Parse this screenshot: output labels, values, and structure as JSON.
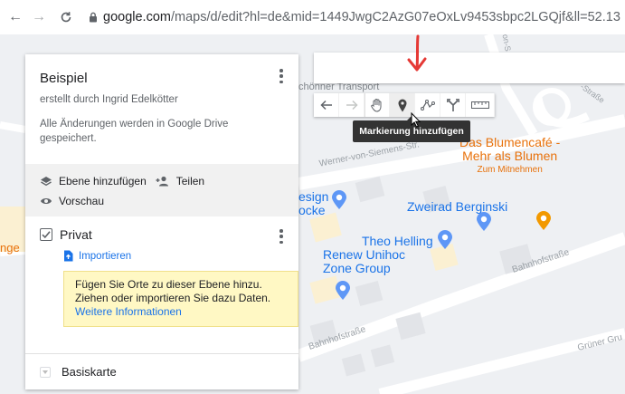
{
  "browser": {
    "url_host": "google.com",
    "url_rest": "/maps/d/edit?hl=de&mid=1449JwgC2AzG07eOxLv9453sbpc2LGQjf&ll=52.13"
  },
  "panel": {
    "title": "Beispiel",
    "author": "erstellt durch Ingrid Edelkötter",
    "saved_note": "Alle Änderungen werden in Google Drive gespeichert.",
    "actions": {
      "add_layer": "Ebene hinzufügen",
      "share": "Teilen",
      "preview": "Vorschau"
    },
    "layer": {
      "name": "Privat",
      "checked": true,
      "import_label": "Importieren",
      "hint_text": "Fügen Sie Orte zu dieser Ebene hinzu. Ziehen oder importieren Sie dazu Daten.",
      "hint_link": "Weitere Informationen"
    },
    "basemap_label": "Basiskarte"
  },
  "toolbar": {
    "tools": [
      "undo-icon",
      "redo-icon",
      "hand-icon",
      "marker-icon",
      "line-icon",
      "route-icon",
      "ruler-icon"
    ],
    "tooltip": "Markierung hinzufügen"
  },
  "map": {
    "pois": {
      "blumencafe_line1": "Das Blumencafé -",
      "blumencafe_line2": "Mehr als Blumen",
      "blumencafe_sub": "Zum Mitnehmen",
      "zweirad": "Zweirad Berginski",
      "theo": "Theo Helling",
      "renew_line1": "Renew Unihoc",
      "renew_line2": "Zone Group",
      "design_line1": "esign",
      "design_line2": "ocke",
      "transport": "chönner Transport",
      "edge_left": "nge"
    },
    "streets": {
      "werner": "Werner-von-Siemens-Str.",
      "bahnhof_right": "Bahnhofstraße",
      "bahnhof_bottom": "Bahnhofstraße",
      "gruener": "Grüner Gru",
      "strasse_top": "-Straße",
      "top_right": "von-S"
    },
    "colors": {
      "accent_blue": "#1a73e8",
      "orange": "#e8710a",
      "annotation_red": "#e53935",
      "hint_bg": "#fff8c4"
    }
  }
}
